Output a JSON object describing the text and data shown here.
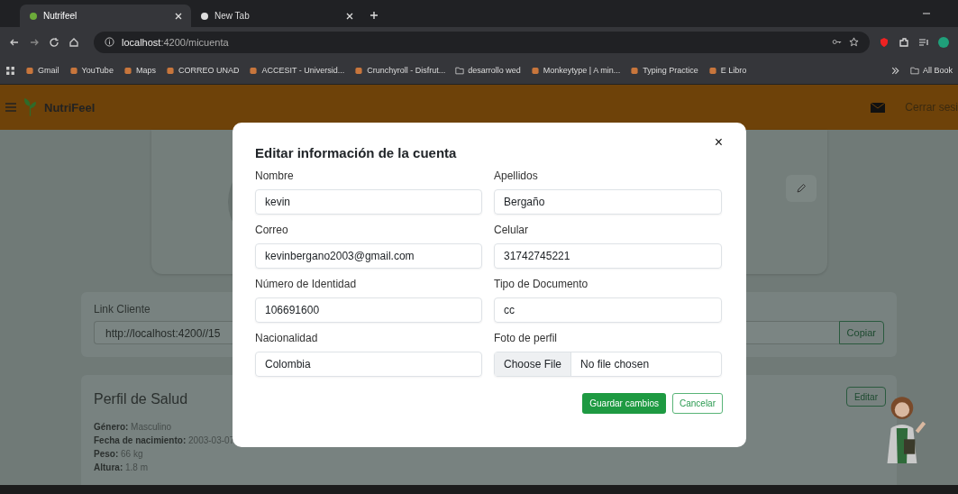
{
  "browser": {
    "tabs": [
      {
        "title": "Nutrifeel",
        "selected": true
      },
      {
        "title": "New Tab",
        "selected": false
      }
    ],
    "address_host": "localhost",
    "address_path": ":4200/micuenta",
    "bookmarks": [
      {
        "label": "Gmail",
        "kind": "site"
      },
      {
        "label": "YouTube",
        "kind": "site"
      },
      {
        "label": "Maps",
        "kind": "site"
      },
      {
        "label": "CORREO UNAD",
        "kind": "site"
      },
      {
        "label": "ACCESIT - Universid...",
        "kind": "site"
      },
      {
        "label": "Crunchyroll - Disfrut...",
        "kind": "site"
      },
      {
        "label": "desarrollo wed",
        "kind": "folder"
      },
      {
        "label": "Monkeytype | A min...",
        "kind": "site"
      },
      {
        "label": "Typing Practice",
        "kind": "site"
      },
      {
        "label": "E Libro",
        "kind": "site"
      }
    ],
    "all_bookmarks": "All Book"
  },
  "navbar": {
    "brand": "NutriFeel",
    "logout": "Cerrar sesi"
  },
  "link_card": {
    "label": "Link Cliente",
    "value": "http://localhost:4200//15",
    "button": "Copiar"
  },
  "health_card": {
    "title": "Perfil de Salud",
    "button": "Editar",
    "facts": [
      {
        "label": "Género:",
        "value": "Masculino"
      },
      {
        "label": "Fecha de nacimiento:",
        "value": "2003-03-07"
      },
      {
        "label": "Peso:",
        "value": "66 kg"
      },
      {
        "label": "Altura:",
        "value": "1.8 m"
      }
    ]
  },
  "modal": {
    "title": "Editar información de la cuenta",
    "close": "×",
    "fields": [
      {
        "label": "Nombre",
        "kind": "text",
        "value": "kevin"
      },
      {
        "label": "Apellidos",
        "kind": "text",
        "value": "Bergaño"
      },
      {
        "label": "Correo",
        "kind": "text",
        "value": "kevinbergano2003@gmail.com"
      },
      {
        "label": "Celular",
        "kind": "text",
        "value": "31742745221"
      },
      {
        "label": "Número de Identidad",
        "kind": "text",
        "value": "106691600"
      },
      {
        "label": "Tipo de Documento",
        "kind": "text",
        "value": "cc"
      },
      {
        "label": "Nacionalidad",
        "kind": "text",
        "value": "Colombia"
      },
      {
        "label": "Foto de perfil",
        "kind": "file",
        "button": "Choose File",
        "value": "No file chosen"
      }
    ],
    "save": "Guardar cambios",
    "cancel": "Cancelar"
  }
}
